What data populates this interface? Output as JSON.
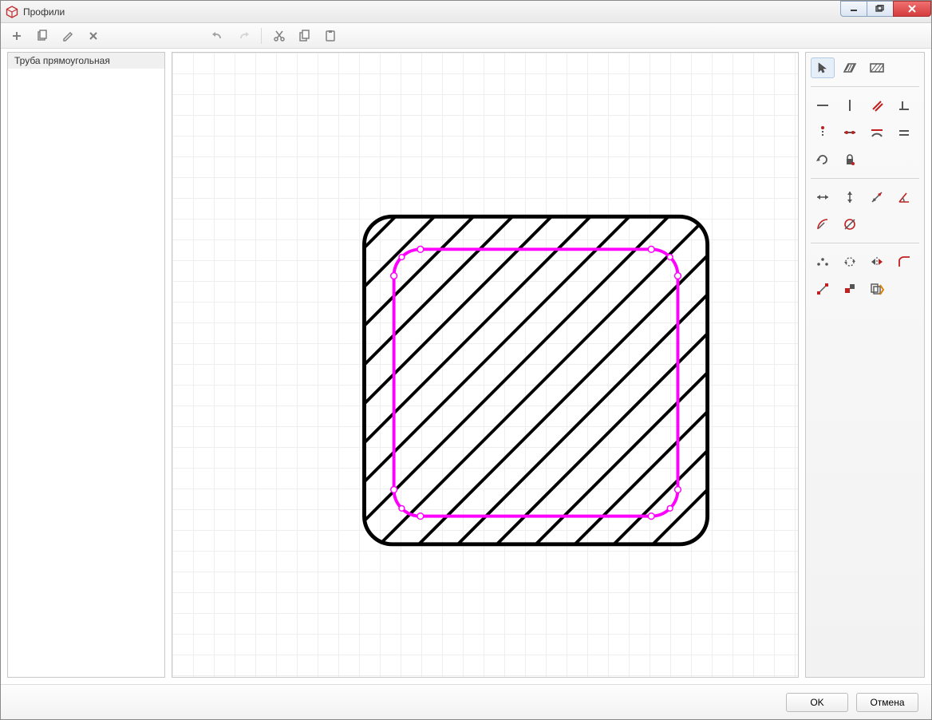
{
  "window": {
    "title": "Профили"
  },
  "toolbar": {
    "add": "add",
    "copy": "copy",
    "edit": "edit",
    "delete": "delete",
    "undo": "undo",
    "redo": "redo",
    "cut": "cut",
    "copy2": "copy",
    "paste": "paste"
  },
  "sidebar": {
    "items": [
      {
        "label": "Труба прямоугольная"
      }
    ]
  },
  "tools": {
    "row1": [
      "pointer",
      "hatch-shape",
      "hatch-body"
    ],
    "row2": [
      "line-horizontal",
      "line-vertical",
      "line-diagonal",
      "corner"
    ],
    "row3": [
      "point",
      "segment",
      "arc",
      "equals"
    ],
    "row4": [
      "circle",
      "lock"
    ],
    "row5": [
      "dim-horizontal",
      "dim-vertical",
      "dim-diagonal",
      "dim-angle"
    ],
    "row6": [
      "dim-radius",
      "dim-diameter"
    ],
    "row7": [
      "constraint-coincident",
      "constraint-concentric",
      "constraint-mirror",
      "constraint-tangent"
    ],
    "row8": [
      "modify-scale",
      "modify-color",
      "modify-autogen"
    ]
  },
  "footer": {
    "ok": "OK",
    "cancel": "Отмена"
  },
  "colors": {
    "selection": "#ff00ff",
    "outline": "#000000",
    "grid": "#eeeeee"
  }
}
